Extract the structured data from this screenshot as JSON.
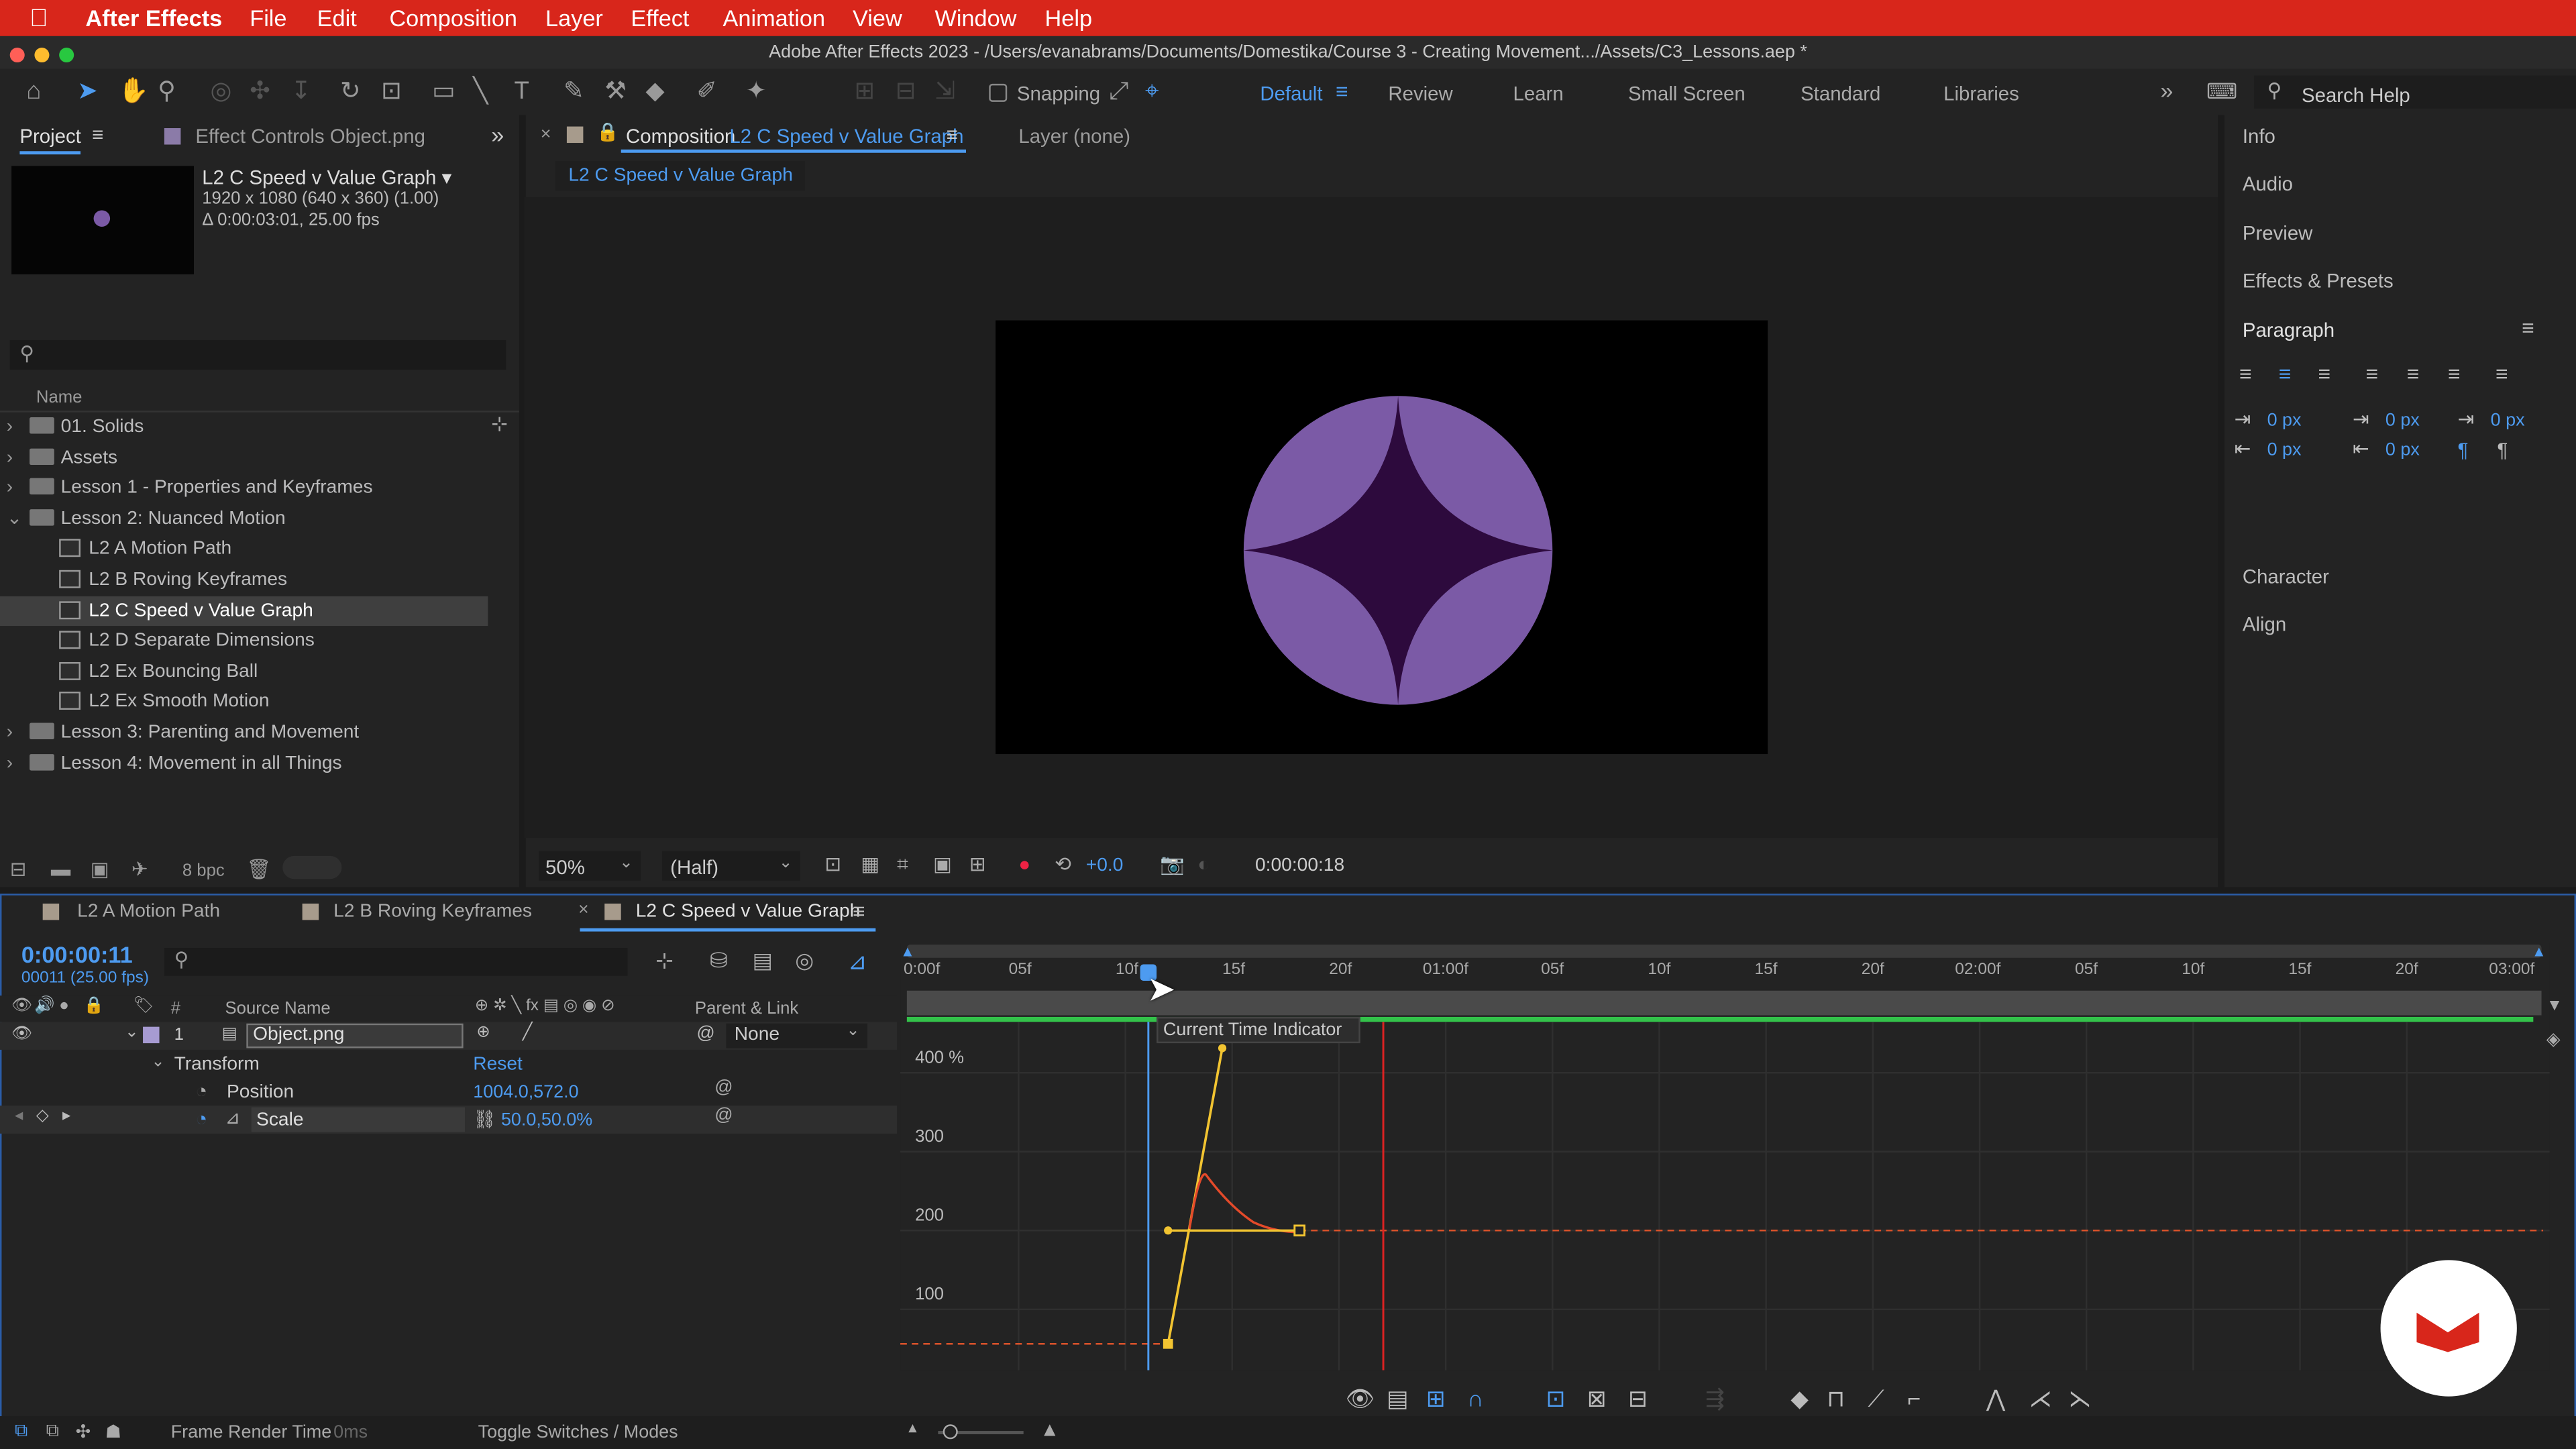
{
  "menubar": {
    "apple": "",
    "app": "After Effects",
    "items": [
      "File",
      "Edit",
      "Composition",
      "Layer",
      "Effect",
      "Animation",
      "View",
      "Window",
      "Help"
    ]
  },
  "window_title": "Adobe After Effects 2023 - /Users/evanabrams/Documents/Domestika/Course 3 - Creating Movement.../Assets/C3_Lessons.aep *",
  "toolbar": {
    "snapping": "Snapping",
    "workspaces": [
      "Default",
      "Review",
      "Learn",
      "Small Screen",
      "Standard",
      "Libraries"
    ],
    "search_placeholder": "Search Help"
  },
  "project": {
    "tab": "Project",
    "effect_tab": "Effect Controls Object.png",
    "comp_name": "L2 C Speed v Value Graph ▾",
    "comp_dims": "1920 x 1080  (640 x 360) (1.00)",
    "comp_dur": "Δ 0:00:03:01, 25.00 fps",
    "col_name": "Name",
    "bpc": "8 bpc",
    "items": [
      {
        "label": "01. Solids",
        "type": "folder",
        "indent": 0,
        "arrow": "›"
      },
      {
        "label": "Assets",
        "type": "folder",
        "indent": 0,
        "arrow": "›"
      },
      {
        "label": "Lesson 1 - Properties and Keyframes",
        "type": "folder",
        "indent": 0,
        "arrow": "›"
      },
      {
        "label": "Lesson 2:  Nuanced Motion",
        "type": "folder",
        "indent": 0,
        "arrow": "⌄"
      },
      {
        "label": "L2 A Motion Path",
        "type": "comp",
        "indent": 1
      },
      {
        "label": "L2 B Roving Keyframes",
        "type": "comp",
        "indent": 1
      },
      {
        "label": "L2 C Speed v Value Graph",
        "type": "comp",
        "indent": 1,
        "selected": true
      },
      {
        "label": "L2 D Separate Dimensions",
        "type": "comp",
        "indent": 1
      },
      {
        "label": "L2 Ex Bouncing Ball",
        "type": "comp",
        "indent": 1
      },
      {
        "label": "L2 Ex Smooth Motion",
        "type": "comp",
        "indent": 1
      },
      {
        "label": "Lesson 3: Parenting and Movement",
        "type": "folder",
        "indent": 0,
        "arrow": "›"
      },
      {
        "label": "Lesson 4: Movement in all Things",
        "type": "folder",
        "indent": 0,
        "arrow": "›"
      }
    ]
  },
  "viewer": {
    "tab_prefix": "Composition",
    "tab_name": "L2 C Speed v Value Graph",
    "layer_tab": "Layer (none)",
    "breadcrumb": "L2 C Speed v Value Graph",
    "zoom": "50%",
    "resolution": "(Half)",
    "exposure": "+0.0",
    "timecode": "0:00:00:18",
    "shape_color": "#7b5aa6",
    "star_color": "#2d0a3d"
  },
  "right_panel": {
    "items": [
      "Info",
      "Audio",
      "Preview",
      "Effects & Presets"
    ],
    "paragraph": "Paragraph",
    "values": [
      "0 px",
      "0 px",
      "0 px",
      "0 px",
      "0 px"
    ],
    "character": "Character",
    "align": "Align"
  },
  "timeline": {
    "tabs": [
      "L2 A Motion Path",
      "L2 B Roving Keyframes",
      "L2 C Speed v Value Graph"
    ],
    "time": "0:00:00:11",
    "frames": "00011 (25.00 fps)",
    "cols": {
      "num": "#",
      "source": "Source Name",
      "parent": "Parent & Link"
    },
    "layer": {
      "num": "1",
      "name": "Object.png",
      "parent": "None"
    },
    "transform": "Transform",
    "reset": "Reset",
    "position": {
      "label": "Position",
      "value": "1004.0,572.0"
    },
    "scale": {
      "label": "Scale",
      "value": "50.0,50.0%"
    },
    "ruler": [
      "0:00f",
      "05f",
      "10f",
      "15f",
      "20f",
      "01:00f",
      "05f",
      "10f",
      "15f",
      "20f",
      "02:00f",
      "05f",
      "10f",
      "15f",
      "20f",
      "03:00f"
    ],
    "tooltip": "Current Time Indicator",
    "graph_labels": [
      "400 %",
      "300",
      "200",
      "100"
    ],
    "frame_render": "Frame Render Time",
    "frame_render_val": "0ms",
    "toggle": "Toggle Switches / Modes"
  }
}
